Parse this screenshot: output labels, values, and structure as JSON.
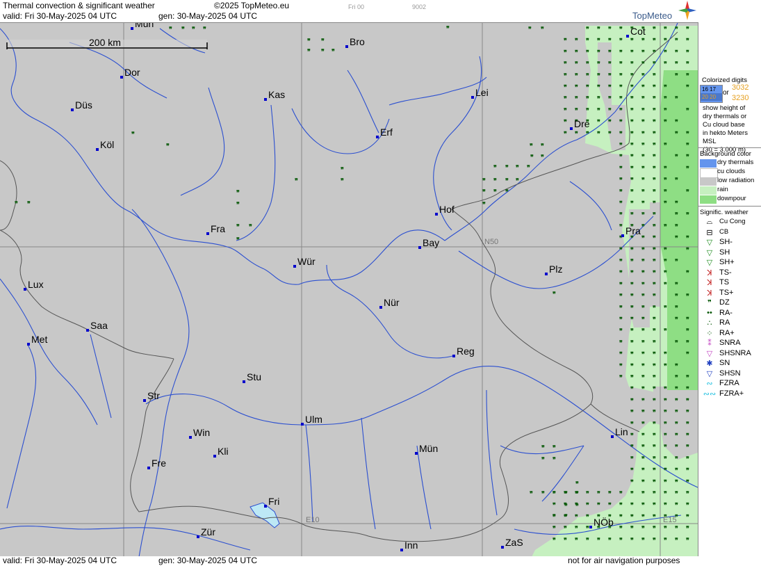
{
  "header": {
    "title": "Thermal convection & significant weather",
    "copyright": "©2025 TopMeteo.eu",
    "valid": "valid:  Fri  30-May-2025  04 UTC",
    "gen": "gen:  30-May-2025 04 UTC",
    "small_tag": "Fri 00",
    "small_code": "9002",
    "logo": "TopMeteo"
  },
  "footer": {
    "valid": "valid:  Fri  30-May-2025  04 UTC",
    "gen": "gen:  30-May-2025 04 UTC",
    "notice": "not for air navigation purposes"
  },
  "map": {
    "scale_label": "200 km",
    "grid_labels": {
      "n50": "N50",
      "e10": "E10",
      "e15": "E15"
    },
    "cities": [
      {
        "name": "Mün",
        "id": "mun-north"
      },
      {
        "name": "Bro",
        "id": "bro"
      },
      {
        "name": "Cot",
        "id": "cot"
      },
      {
        "name": "Dor",
        "id": "dor"
      },
      {
        "name": "Kas",
        "id": "kas"
      },
      {
        "name": "Lei",
        "id": "lei"
      },
      {
        "name": "Düs",
        "id": "dus"
      },
      {
        "name": "Erf",
        "id": "erf"
      },
      {
        "name": "Dre",
        "id": "dre"
      },
      {
        "name": "Köl",
        "id": "kol"
      },
      {
        "name": "Hof",
        "id": "hof"
      },
      {
        "name": "Fra",
        "id": "fra"
      },
      {
        "name": "Pra",
        "id": "pra"
      },
      {
        "name": "Bay",
        "id": "bay"
      },
      {
        "name": "Wür",
        "id": "wur"
      },
      {
        "name": "Plz",
        "id": "plz"
      },
      {
        "name": "Lux",
        "id": "lux"
      },
      {
        "name": "Nür",
        "id": "nur"
      },
      {
        "name": "Saa",
        "id": "saa"
      },
      {
        "name": "Met",
        "id": "met"
      },
      {
        "name": "Reg",
        "id": "reg"
      },
      {
        "name": "Stu",
        "id": "stu"
      },
      {
        "name": "Str",
        "id": "str"
      },
      {
        "name": "Ulm",
        "id": "ulm"
      },
      {
        "name": "Win",
        "id": "win"
      },
      {
        "name": "Lin",
        "id": "lin"
      },
      {
        "name": "Kli",
        "id": "kli"
      },
      {
        "name": "Mün",
        "id": "mun"
      },
      {
        "name": "Fre",
        "id": "fre"
      },
      {
        "name": "Fri",
        "id": "fri"
      },
      {
        "name": "NÖb",
        "id": "nob"
      },
      {
        "name": "Zür",
        "id": "zur"
      },
      {
        "name": "Inn",
        "id": "inn"
      },
      {
        "name": "ZaS",
        "id": "zas"
      }
    ]
  },
  "legend": {
    "colorized_title": "Colorized digits",
    "or": "or",
    "digits_a": "3032",
    "digits_b": "3230",
    "box_digits_top": "16 17",
    "box_digits_bottom": "20 20",
    "desc": [
      "show height of",
      "dry thermals or",
      "Cu cloud base",
      "in hekto Meters",
      "MSL",
      "(30 = 3.000 m)"
    ],
    "bg_title": "Background color",
    "bg_items": [
      {
        "label": "dry thermals",
        "color": "#6495ed"
      },
      {
        "label": "cu clouds",
        "color": "#ffffff"
      },
      {
        "label": "low radiation",
        "color": "#c8c8c8"
      },
      {
        "label": "rain",
        "color": "#c6f0c0"
      },
      {
        "label": "downpour",
        "color": "#8ede84"
      }
    ],
    "wx_title": "Signific. weather",
    "wx_items": [
      {
        "label": "Cu Cong",
        "icon": "cu-cong-icon",
        "glyph": "⌓",
        "color": "#000000"
      },
      {
        "label": "CB",
        "icon": "cb-icon",
        "glyph": "⊟",
        "color": "#000000"
      },
      {
        "label": "SH-",
        "icon": "shower-light-icon",
        "glyph": "▽",
        "color": "#1a8a1a"
      },
      {
        "label": "SH",
        "icon": "shower-icon",
        "glyph": "▽",
        "color": "#1a8a1a"
      },
      {
        "label": "SH+",
        "icon": "shower-heavy-icon",
        "glyph": "▽",
        "color": "#1a8a1a"
      },
      {
        "label": "TS-",
        "icon": "thunderstorm-light-icon",
        "glyph": "ꓘ",
        "color": "#c01818"
      },
      {
        "label": "TS",
        "icon": "thunderstorm-icon",
        "glyph": "ꓘ",
        "color": "#c01818"
      },
      {
        "label": "TS+",
        "icon": "thunderstorm-heavy-icon",
        "glyph": "ꓘ",
        "color": "#c01818"
      },
      {
        "label": "DZ",
        "icon": "drizzle-icon",
        "glyph": "❞",
        "color": "#0a5a0a"
      },
      {
        "label": "RA-",
        "icon": "rain-light-icon",
        "glyph": "••",
        "color": "#0a5a0a"
      },
      {
        "label": "RA",
        "icon": "rain-icon",
        "glyph": "∴",
        "color": "#0a5a0a"
      },
      {
        "label": "RA+",
        "icon": "rain-heavy-icon",
        "glyph": "⁘",
        "color": "#0a5a0a"
      },
      {
        "label": "SNRA",
        "icon": "snow-rain-icon",
        "glyph": "⁑",
        "color": "#c040c0"
      },
      {
        "label": "SHSNRA",
        "icon": "snow-rain-shower-icon",
        "glyph": "▽",
        "color": "#c040c0"
      },
      {
        "label": "SN",
        "icon": "snow-icon",
        "glyph": "✱",
        "color": "#2040c0"
      },
      {
        "label": "SHSN",
        "icon": "snow-shower-icon",
        "glyph": "▽",
        "color": "#2040c0"
      },
      {
        "label": "FZRA",
        "icon": "freezing-rain-icon",
        "glyph": "∾",
        "color": "#20c0e0"
      },
      {
        "label": "FZRA+",
        "icon": "freezing-rain-heavy-icon",
        "glyph": "∾∾",
        "color": "#20c0e0"
      }
    ]
  }
}
